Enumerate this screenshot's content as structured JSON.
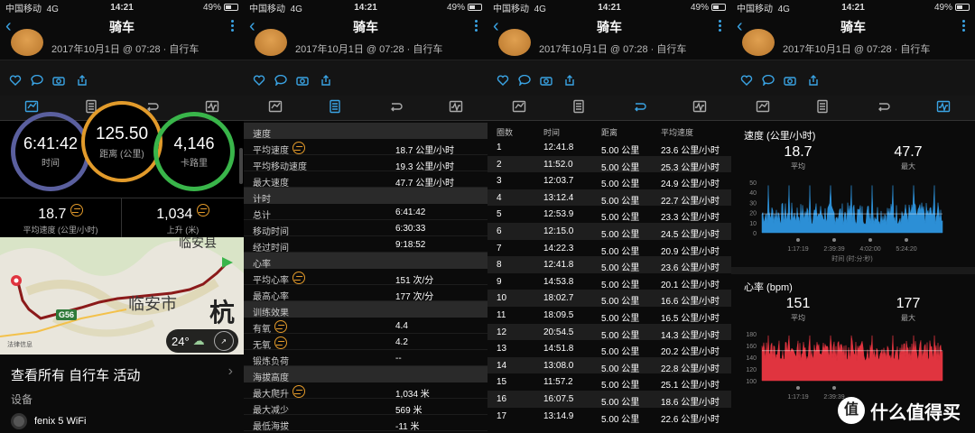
{
  "status": {
    "carrier": "中国移动",
    "net": "4G",
    "time": "14:21",
    "battery": "49%"
  },
  "nav": {
    "title": "骑车"
  },
  "header": {
    "date": "2017年10月1日 @ 07:28 · 自行车"
  },
  "summary": {
    "time": {
      "value": "6:41:42",
      "label": "时间"
    },
    "distance": {
      "value": "125.50",
      "label": "距离 (公里)"
    },
    "calories": {
      "value": "4,146",
      "label": "卡路里"
    },
    "avg_speed": {
      "value": "18.7",
      "label": "平均速度 (公里/小时)"
    },
    "ascent": {
      "value": "1,034",
      "label": "上升 (米)"
    }
  },
  "map": {
    "city": "临安市",
    "hang": "杭",
    "road": "G56",
    "top_label": "临安县",
    "temp": "24°",
    "legal": "法律信息"
  },
  "more_link": "查看所有 自行车 活动",
  "device_header": "设备",
  "device_name": "fenix 5 WiFi",
  "details": [
    {
      "section": "速度",
      "rows": [
        {
          "k": "平均速度",
          "v": "18.7 公里/小时",
          "icon": true
        },
        {
          "k": "平均移动速度",
          "v": "19.3 公里/小时"
        },
        {
          "k": "最大速度",
          "v": "47.7 公里/小时"
        }
      ]
    },
    {
      "section": "计时",
      "rows": [
        {
          "k": "总计",
          "v": "6:41:42"
        },
        {
          "k": "移动时间",
          "v": "6:30:33"
        },
        {
          "k": "经过时间",
          "v": "9:18:52"
        }
      ]
    },
    {
      "section": "心率",
      "rows": [
        {
          "k": "平均心率",
          "v": "151 次/分",
          "icon": true
        },
        {
          "k": "最高心率",
          "v": "177 次/分"
        }
      ]
    },
    {
      "section": "训练效果",
      "rows": [
        {
          "k": "有氧",
          "v": "4.4",
          "icon": true
        },
        {
          "k": "无氧",
          "v": "4.2",
          "icon": true
        },
        {
          "k": "锻炼负荷",
          "v": "--"
        }
      ]
    },
    {
      "section": "海拔高度",
      "rows": [
        {
          "k": "最大爬升",
          "v": "1,034 米",
          "icon": true
        },
        {
          "k": "最大减少",
          "v": "569 米"
        },
        {
          "k": "最低海拔",
          "v": "-11 米"
        }
      ]
    }
  ],
  "laps_header": [
    "圈数",
    "时间",
    "距离",
    "平均速度"
  ],
  "laps": [
    [
      "1",
      "12:41.8",
      "5.00 公里",
      "23.6 公里/小时"
    ],
    [
      "2",
      "11:52.0",
      "5.00 公里",
      "25.3 公里/小时"
    ],
    [
      "3",
      "12:03.7",
      "5.00 公里",
      "24.9 公里/小时"
    ],
    [
      "4",
      "13:12.4",
      "5.00 公里",
      "22.7 公里/小时"
    ],
    [
      "5",
      "12:53.9",
      "5.00 公里",
      "23.3 公里/小时"
    ],
    [
      "6",
      "12:15.0",
      "5.00 公里",
      "24.5 公里/小时"
    ],
    [
      "7",
      "14:22.3",
      "5.00 公里",
      "20.9 公里/小时"
    ],
    [
      "8",
      "12:41.8",
      "5.00 公里",
      "23.6 公里/小时"
    ],
    [
      "9",
      "14:53.8",
      "5.00 公里",
      "20.1 公里/小时"
    ],
    [
      "10",
      "18:02.7",
      "5.00 公里",
      "16.6 公里/小时"
    ],
    [
      "11",
      "18:09.5",
      "5.00 公里",
      "16.5 公里/小时"
    ],
    [
      "12",
      "20:54.5",
      "5.00 公里",
      "14.3 公里/小时"
    ],
    [
      "13",
      "14:51.8",
      "5.00 公里",
      "20.2 公里/小时"
    ],
    [
      "14",
      "13:08.0",
      "5.00 公里",
      "22.8 公里/小时"
    ],
    [
      "15",
      "11:57.2",
      "5.00 公里",
      "25.1 公里/小时"
    ],
    [
      "16",
      "16:07.5",
      "5.00 公里",
      "18.6 公里/小时"
    ],
    [
      "17",
      "13:14.9",
      "5.00 公里",
      "22.6 公里/小时"
    ]
  ],
  "speed_chart": {
    "title": "速度 (公里/小时)",
    "avg": "18.7",
    "avg_label": "平均",
    "max": "47.7",
    "max_label": "最大",
    "yticks": [
      "50",
      "40",
      "30",
      "20",
      "10",
      "0"
    ],
    "xticks": [
      "1:17:19",
      "2:39:39",
      "4:02:00",
      "5:24:20"
    ],
    "xlabel": "时间 (时:分:秒)"
  },
  "hr_chart": {
    "title": "心率 (bpm)",
    "avg": "151",
    "avg_label": "平均",
    "max": "177",
    "max_label": "最大",
    "yticks": [
      "180",
      "160",
      "140",
      "120",
      "100"
    ],
    "xticks": [
      "1:17:19",
      "2:39:39"
    ]
  },
  "watermark": {
    "badge": "值",
    "text": "什么值得买"
  },
  "colors": {
    "accent": "#3aa3e3",
    "time_ring": "#5a5f9e",
    "distance_ring": "#e29b2b",
    "cal_ring": "#39b54a",
    "speed_fill": "#2c8fd6",
    "hr_fill": "#e0343f"
  }
}
